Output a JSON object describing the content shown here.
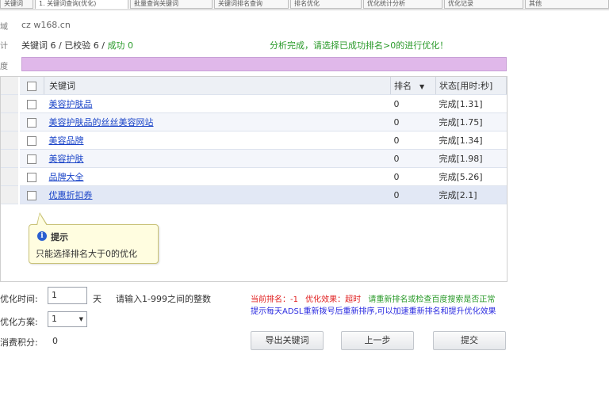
{
  "tabs": [
    "关键词",
    "1. 关键词查询(优化)",
    "批量查询关键词",
    "关键词排名查询",
    "排名优化",
    "优化统计分析",
    "优化记录",
    "其他"
  ],
  "header": {
    "domain_label": "域",
    "domain_value": "cz w168.cn",
    "counts_label": "计",
    "keywords_label": "关键词",
    "keywords_count": "6",
    "checked_label": "已校验",
    "checked_count": "6",
    "success_label": "成功",
    "success_count": "0",
    "status_message": "分析完成，请选择已成功排名>0的进行优化！",
    "progress_label": "度",
    "progress_fraction": 1.0
  },
  "table": {
    "columns": {
      "keyword": "关键词",
      "rank": "排名",
      "status": "状态[用时:秒]"
    },
    "rows": [
      {
        "keyword": "美容护肤品",
        "rank": "0",
        "status": "完成[1.31]"
      },
      {
        "keyword": "美容护肤品的丝丝美容网站",
        "rank": "0",
        "status": "完成[1.75]"
      },
      {
        "keyword": "美容品牌",
        "rank": "0",
        "status": "完成[1.34]"
      },
      {
        "keyword": "美容护肤",
        "rank": "0",
        "status": "完成[1.98]"
      },
      {
        "keyword": "品牌大全",
        "rank": "0",
        "status": "完成[5.26]"
      },
      {
        "keyword": "优惠折扣券",
        "rank": "0",
        "status": "完成[2.1]"
      }
    ]
  },
  "tooltip": {
    "title": "提示",
    "body": "只能选择排名大于0的优化"
  },
  "form": {
    "time_label": "优化时间:",
    "time_value": "1",
    "time_unit": "天",
    "time_hint": "请输入1-999之间的整数",
    "plan_label": "优化方案:",
    "plan_value": "1",
    "points_label": "消费积分:",
    "points_value": "0"
  },
  "notice": {
    "rank_label": "当前排名：",
    "rank_value": "-1",
    "state_label": "优化效果：",
    "state_value": "超时",
    "tip_green": "请重新排名或检查百度搜索是否正常",
    "tip_blue": "提示每天ADSL重新拨号后重新排序,可以加速重新排名和提升优化效果"
  },
  "buttons": {
    "export": "导出关键词",
    "prev": "上一步",
    "submit": "提交"
  }
}
